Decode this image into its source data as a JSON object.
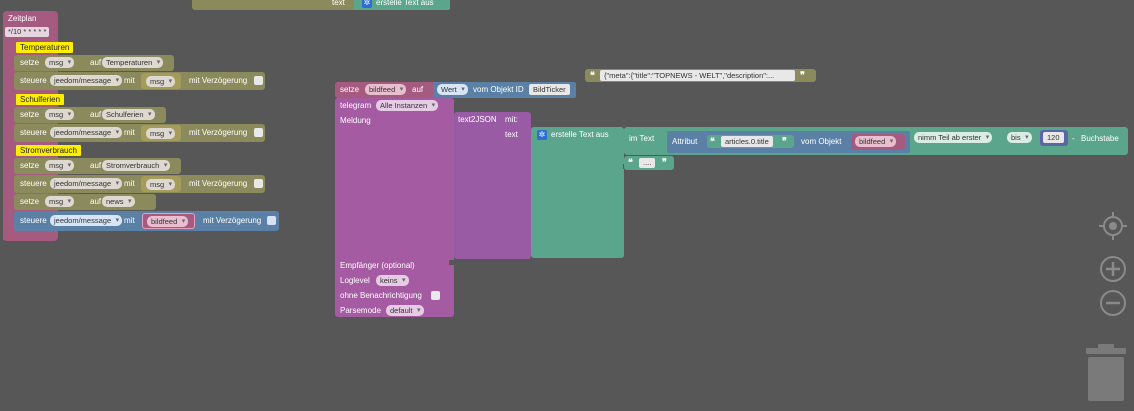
{
  "top_fragment": {
    "text_label": "text",
    "create_label": "erstelle Text aus"
  },
  "schedule": {
    "title": "Zeitplan",
    "cron": "*/10 * * * * *",
    "sections": [
      {
        "label": "Temperaturen",
        "set_var": "msg",
        "set_value": "Temperaturen",
        "ctrl_state": "jeedom/message",
        "ctrl_var": "msg"
      },
      {
        "label": "Schulferien",
        "set_var": "msg",
        "set_value": "Schulferien",
        "ctrl_state": "jeedom/message",
        "ctrl_var": "msg"
      },
      {
        "label": "Stromverbrauch",
        "set_var": "msg",
        "set_value": "Stromverbrauch",
        "ctrl_state": "jeedom/message",
        "ctrl_var": "msg"
      }
    ],
    "news_set": {
      "var": "msg",
      "value": "news"
    },
    "final_ctrl": {
      "state": "jeedom/message",
      "var": "bildfeed"
    },
    "words": {
      "setze": "setze",
      "auf": "auf",
      "steuere": "steuere",
      "mit": "mit",
      "delay": "mit Verzögerung"
    }
  },
  "main": {
    "set_label": "setze",
    "set_var": "bildfeed",
    "auf": "auf",
    "value_dd": "Wert",
    "from_object": "vom Objekt ID",
    "object_id": "BildTicker",
    "json_preview": "{\"meta\":{\"title\":\"TOPNEWS - WELT\",\"description\":...",
    "telegram_label": "telegram",
    "telegram_instance": "Alle Instanzen",
    "meldung": "Meldung",
    "text2json": "text2JSON",
    "mit": "mit:",
    "text": "text",
    "create_text": "erstelle Text aus",
    "im_text": "im Text",
    "attribut": "Attribut",
    "attr_value": "articles.0.title",
    "vom_objekt": "vom Objekt",
    "obj_var": "bildfeed",
    "nimm": "nimm Teil ab erster",
    "bis": "bis",
    "num": "120",
    "minus": "-",
    "buchstabe": "Buchstabe",
    "dots": "....",
    "empfaenger": "Empfänger (optional)",
    "loglevel": "Loglevel",
    "loglevel_value": "keins",
    "ohne": "ohne Benachrichtigung",
    "parsemode": "Parsemode",
    "parsemode_value": "default"
  },
  "colors": {
    "workspace": "#575757",
    "schedule": "#a55b80",
    "state": "#8a8a5c",
    "telegram": "#a55ba1",
    "text": "#5ba58c",
    "json": "#9a5ba5",
    "control_blue": "#5b80a5"
  }
}
